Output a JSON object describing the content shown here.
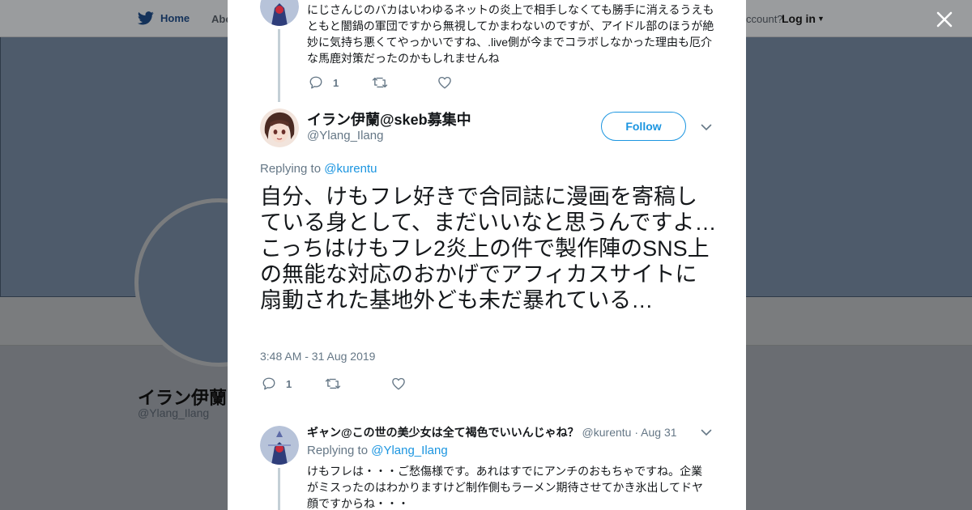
{
  "background": {
    "nav": {
      "home": "Home",
      "about": "Abo",
      "account_prompt": "ccount?",
      "login": "Log in"
    },
    "profile_name": "イラン伊蘭@",
    "profile_handle": "@Ylang_Ilang"
  },
  "modal": {
    "prev_tweet": {
      "text": "にじさんじのバカはいわゆるネットの炎上で相手しなくても勝手に消えるうえもともと闇鍋の軍団ですから無視してかまわないのですが、アイドル部のほうが絶妙に気持ち悪くてやっかいですね、.live側が今までコラボしなかった理由も厄介な馬鹿対策だったのかもしれませんね",
      "reply_count": "1"
    },
    "main_tweet": {
      "name": "イラン伊蘭@skeb募集中",
      "handle": "@Ylang_Ilang",
      "follow_label": "Follow",
      "replying_prefix": "Replying to",
      "replying_to": "@kurentu",
      "text": "自分、けもフレ好きで合同誌に漫画を寄稿している身として、まだいいなと思うんですよ…こっちはけもフレ2炎上の件で製作陣のSNS上の無能な対応のおかげでアフィカスサイトに扇動された基地外ども未だ暴れている…",
      "timestamp": "3:48 AM - 31 Aug 2019",
      "reply_count": "1"
    },
    "reply_tweet": {
      "name": "ギャン@この世の美少女は全て褐色でいいんじゃね？",
      "handle": "@kurentu",
      "date": "· Aug 31",
      "replying_prefix": "Replying to",
      "replying_to": "@Ylang_Ilang",
      "text": "けもフレは・・・ご愁傷様です。あれはすでにアンチのおもちゃですね。企業がミスったのはわかりますけど制作側もラーメン期待させてかき氷出してドヤ顔ですからね・・・"
    }
  },
  "icons": [
    "twitter-bird-icon",
    "close-icon",
    "reply-icon",
    "retweet-icon",
    "like-icon",
    "chevron-down-icon"
  ],
  "colors": {
    "accent": "#1b95e0",
    "text": "#14171a",
    "secondary": "#657786",
    "overlay": "#6a6d72"
  }
}
